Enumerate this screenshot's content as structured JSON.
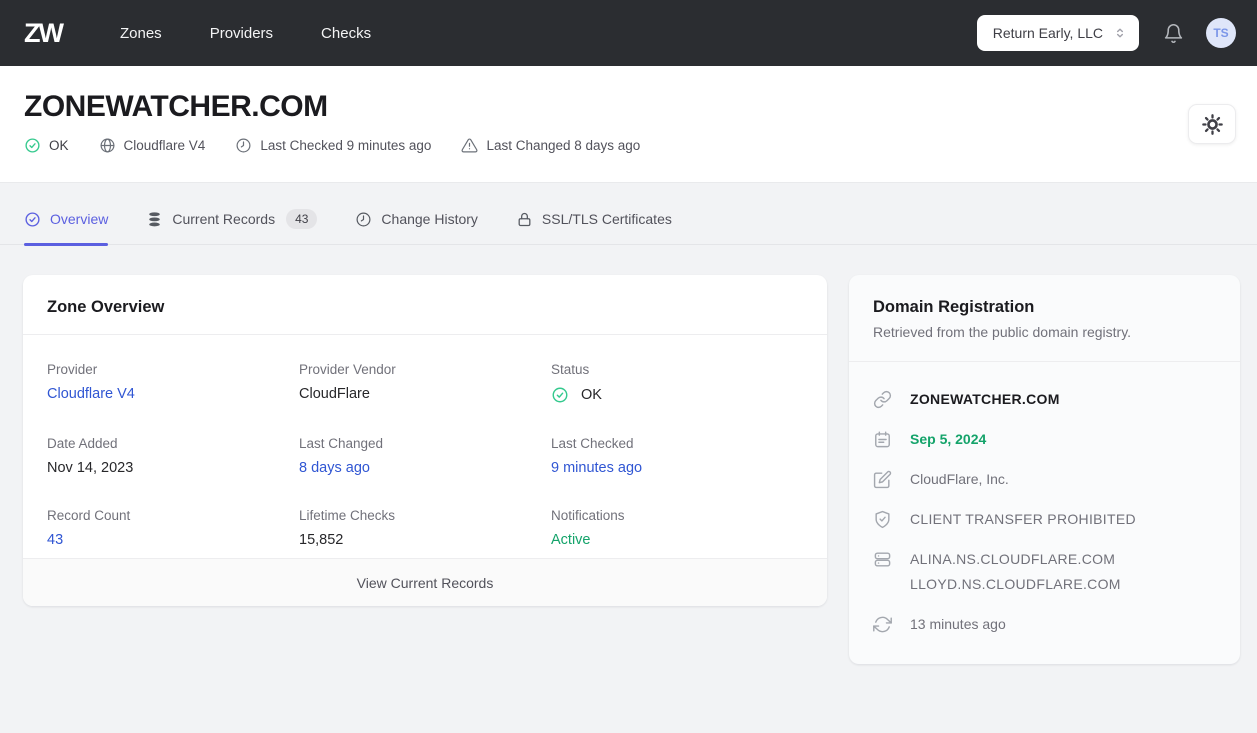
{
  "colors": {
    "nav_bg": "#2b2d31",
    "accent_indigo": "#5b5fe0",
    "link_blue": "#3056d3",
    "status_green": "#14a36a",
    "icon_green": "#35c98e",
    "page_bg": "#f2f3f5"
  },
  "nav": {
    "logo": "ZW",
    "items": [
      {
        "label": "Zones"
      },
      {
        "label": "Providers"
      },
      {
        "label": "Checks"
      }
    ],
    "org_selector": "Return Early, LLC",
    "avatar_initials": "TS"
  },
  "header": {
    "title": "ZONEWATCHER.COM",
    "meta": [
      {
        "icon": "check-circle",
        "label": "OK"
      },
      {
        "icon": "globe",
        "label": "Cloudflare V4"
      },
      {
        "icon": "clock",
        "label": "Last Checked 9 minutes ago"
      },
      {
        "icon": "alert-triangle",
        "label": "Last Changed 8 days ago"
      }
    ]
  },
  "tabs": [
    {
      "label": "Overview",
      "icon": "check-circle",
      "active": true
    },
    {
      "label": "Current Records",
      "icon": "database",
      "badge": "43"
    },
    {
      "label": "Change History",
      "icon": "clock"
    },
    {
      "label": "SSL/TLS Certificates",
      "icon": "lock"
    }
  ],
  "zone_overview": {
    "title": "Zone Overview",
    "fields": [
      {
        "label": "Provider",
        "value": "Cloudflare V4"
      },
      {
        "label": "Provider Vendor",
        "value": "CloudFlare"
      },
      {
        "label": "Status",
        "value": "OK"
      },
      {
        "label": "Date Added",
        "value": "Nov 14, 2023"
      },
      {
        "label": "Last Changed",
        "value": "8 days ago"
      },
      {
        "label": "Last Checked",
        "value": "9 minutes ago"
      },
      {
        "label": "Record Count",
        "value": "43"
      },
      {
        "label": "Lifetime Checks",
        "value": "15,852"
      },
      {
        "label": "Notifications",
        "value": "Active"
      }
    ],
    "footer_action": "View Current Records"
  },
  "domain_registration": {
    "title": "Domain Registration",
    "subtitle": "Retrieved from the public domain registry.",
    "items": [
      {
        "icon": "link",
        "value": "ZONEWATCHER.COM"
      },
      {
        "icon": "calendar",
        "value": "Sep 5, 2024"
      },
      {
        "icon": "edit",
        "value": "CloudFlare, Inc."
      },
      {
        "icon": "shield-check",
        "value": "CLIENT TRANSFER PROHIBITED"
      },
      {
        "icon": "server",
        "values": [
          "ALINA.NS.CLOUDFLARE.COM",
          "LLOYD.NS.CLOUDFLARE.COM"
        ]
      },
      {
        "icon": "refresh",
        "value": "13 minutes ago"
      }
    ]
  }
}
